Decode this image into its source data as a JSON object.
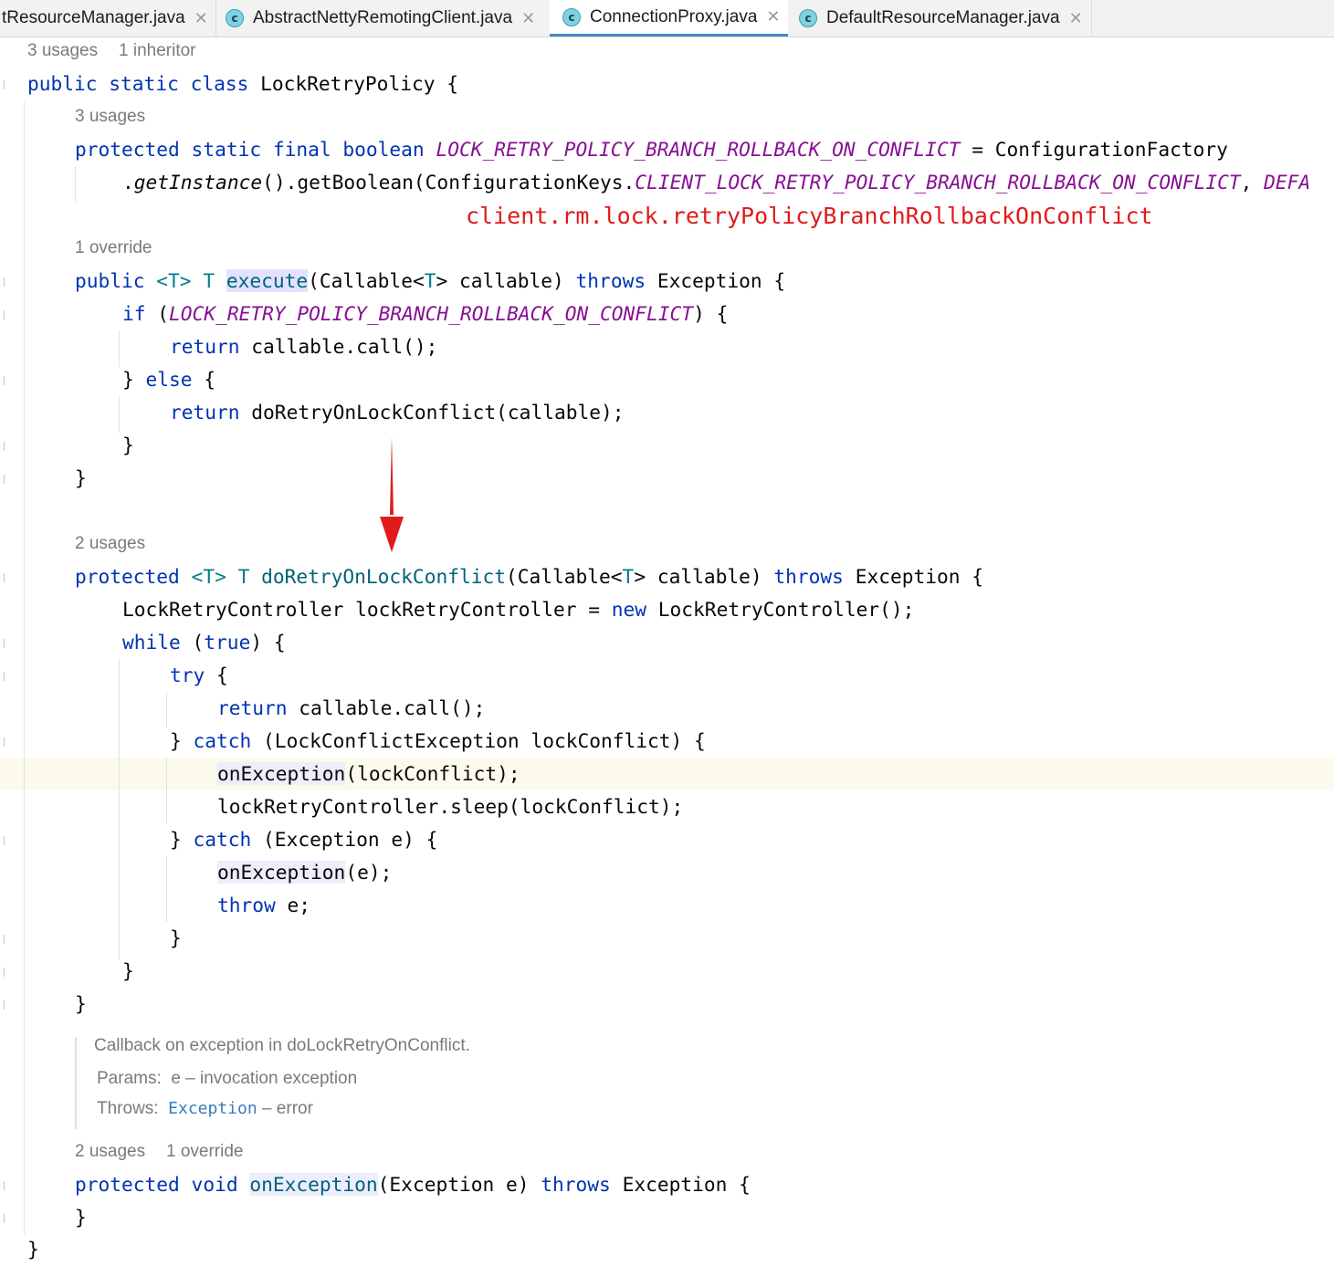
{
  "tabs": [
    {
      "label": "tResourceManager.java",
      "icon": "none",
      "active": false
    },
    {
      "label": "AbstractNettyRemotingClient.java",
      "icon": "class-icon",
      "active": false
    },
    {
      "label": "ConnectionProxy.java",
      "icon": "class-icon",
      "active": true
    },
    {
      "label": "DefaultResourceManager.java",
      "icon": "class-icon",
      "active": false
    }
  ],
  "tab_close": "✕",
  "class_icon_letter": "c",
  "hints": {
    "class_usages": "3 usages",
    "class_inheritors": "1 inheritor",
    "field_usages": "3 usages",
    "execute_override": "1 override",
    "retry_usages": "2 usages",
    "onexc_usages": "2 usages",
    "onexc_override": "1 override"
  },
  "code": {
    "l1_kw": "public static class ",
    "l1_name": "LockRetryPolicy {",
    "l2_kw": "protected static final boolean ",
    "l2_const": "LOCK_RETRY_POLICY_BRANCH_ROLLBACK_ON_CONFLICT",
    "l2_rest": " = ConfigurationFactory",
    "l3_dot": ".",
    "l3_getinst": "getInstance",
    "l3_mid": "().getBoolean(ConfigurationKeys.",
    "l3_const": "CLIENT_LOCK_RETRY_POLICY_BRANCH_ROLLBACK_ON_CONFLICT",
    "l3_end": ", ",
    "l3_const2": "DEFA",
    "l4_kw": "public ",
    "l4_tp1": "<T> T ",
    "l4_fn": "execute",
    "l4_a": "(Callable<",
    "l4_tp2": "T",
    "l4_b": "> callable) ",
    "l4_throws": "throws",
    "l4_c": " Exception {",
    "l5_if": "if ",
    "l5_paren": "(",
    "l5_const": "LOCK_RETRY_POLICY_BRANCH_ROLLBACK_ON_CONFLICT",
    "l5_end": ") {",
    "l6_kw": "return ",
    "l6_rest": "callable.call();",
    "l7_a": "} ",
    "l7_else": "else",
    "l7_b": " {",
    "l8_kw": "return ",
    "l8_rest": "doRetryOnLockConflict(callable);",
    "close_brace": "}",
    "l10_kw": "protected ",
    "l10_tp1": "<T> T ",
    "l10_fn": "doRetryOnLockConflict",
    "l10_a": "(Callable<",
    "l10_tp2": "T",
    "l10_b": "> callable) ",
    "l10_throws": "throws",
    "l10_c": " Exception {",
    "l11_a": "LockRetryController lockRetryController = ",
    "l11_new": "new",
    "l11_b": " LockRetryController();",
    "l12_while": "while",
    "l12_a": " (",
    "l12_true": "true",
    "l12_b": ") {",
    "l13_try": "try",
    "l13_b": " {",
    "l14_kw": "return ",
    "l14_rest": "callable.call();",
    "l15_a": "} ",
    "l15_catch": "catch",
    "l15_b": " (LockConflictException lockConflict) {",
    "l16_fn": "onException",
    "l16_rest": "(lockConflict);",
    "l17": "lockRetryController.sleep(lockConflict);",
    "l18_a": "} ",
    "l18_catch": "catch",
    "l18_b": " (Exception e) {",
    "l19_fn": "onException",
    "l19_rest": "(e);",
    "l20_throw": "throw",
    "l20_rest": " e;",
    "l21_kw": "protected void ",
    "l21_fn": "onException",
    "l21_a": "(Exception e) ",
    "l21_throws": "throws",
    "l21_b": " Exception {"
  },
  "annotation": "client.rm.lock.retryPolicyBranchRollbackOnConflict",
  "doc": {
    "summary": "Callback on exception in doLockRetryOnConflict.",
    "params_label": "Params:",
    "params_text": "e – invocation exception",
    "throws_label": "Throws:",
    "throws_link": "Exception",
    "throws_text": " – error"
  },
  "colors": {
    "keyword": "#0033b3",
    "type_param": "#007e8a",
    "constant": "#871094",
    "annotation": "#e01b1b",
    "arrow": "#e01b1b",
    "caret_line": "#fcfaed"
  }
}
